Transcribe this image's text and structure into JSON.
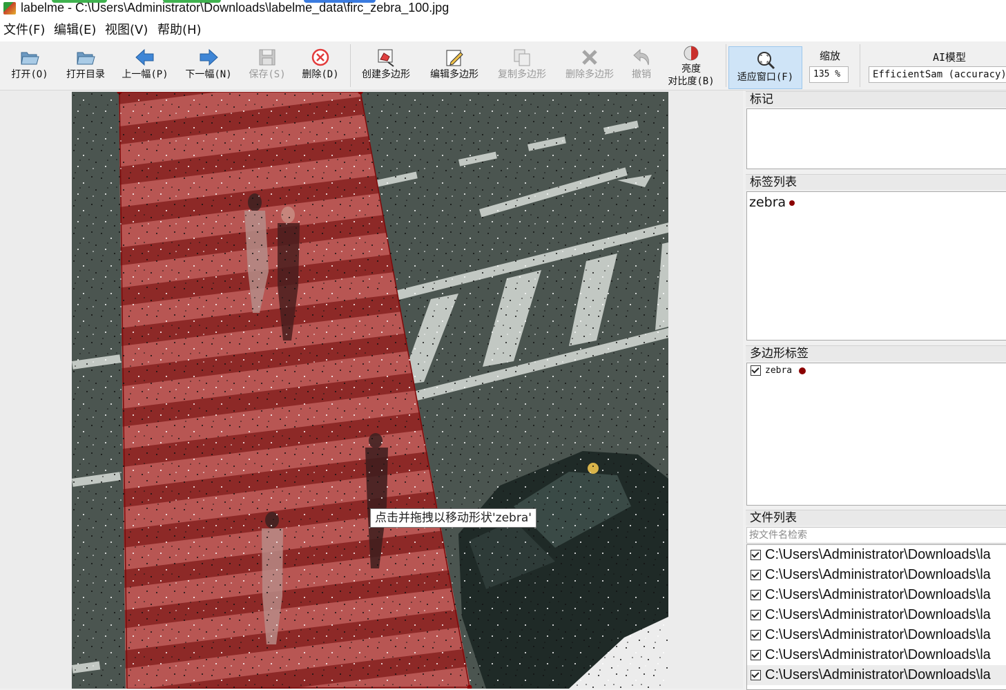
{
  "window": {
    "title": "labelme - C:\\Users\\Administrator\\Downloads\\labelme_data\\firc_zebra_100.jpg"
  },
  "menu": [
    {
      "label": "文件(F)"
    },
    {
      "label": "编辑(E)"
    },
    {
      "label": "视图(V)"
    },
    {
      "label": "帮助(H)"
    }
  ],
  "toolbar": {
    "open": "打开(O)",
    "open_dir": "打开目录",
    "prev": "上一幅(P)",
    "next": "下一幅(N)",
    "save": "保存(S)",
    "delete": "删除(D)",
    "create_polygon": "创建多边形",
    "edit_polygon": "编辑多边形",
    "copy_polygon": "复制多边形",
    "delete_polygon": "删除多边形",
    "undo": "撤销",
    "brightness_line1": "亮度",
    "brightness_line2": "对比度(B)",
    "fit_window": "适应窗口(F)",
    "zoom_label": "缩放",
    "zoom_value": "135 %",
    "ai_label": "AI模型",
    "ai_model": "EfficientSam (accuracy)"
  },
  "canvas": {
    "tooltip": "点击并拖拽以移动形状'zebra'",
    "shape_color": "#8b0000"
  },
  "docks": {
    "flags_title": "标记",
    "label_list_title": "标签列表",
    "label_list": [
      {
        "label": "zebra",
        "color": "#8b0000"
      }
    ],
    "polygon_labels_title": "多边形标签",
    "polygon_labels": [
      {
        "label": "zebra",
        "checked": true,
        "color": "#8b0000"
      }
    ],
    "file_list_title": "文件列表",
    "file_search_placeholder": "按文件名检索",
    "files": [
      {
        "path": "C:\\Users\\Administrator\\Downloads\\la",
        "checked": true
      },
      {
        "path": "C:\\Users\\Administrator\\Downloads\\la",
        "checked": true
      },
      {
        "path": "C:\\Users\\Administrator\\Downloads\\la",
        "checked": true
      },
      {
        "path": "C:\\Users\\Administrator\\Downloads\\la",
        "checked": true
      },
      {
        "path": "C:\\Users\\Administrator\\Downloads\\la",
        "checked": true
      },
      {
        "path": "C:\\Users\\Administrator\\Downloads\\la",
        "checked": true
      },
      {
        "path": "C:\\Users\\Administrator\\Downloads\\la",
        "checked": true
      }
    ]
  }
}
